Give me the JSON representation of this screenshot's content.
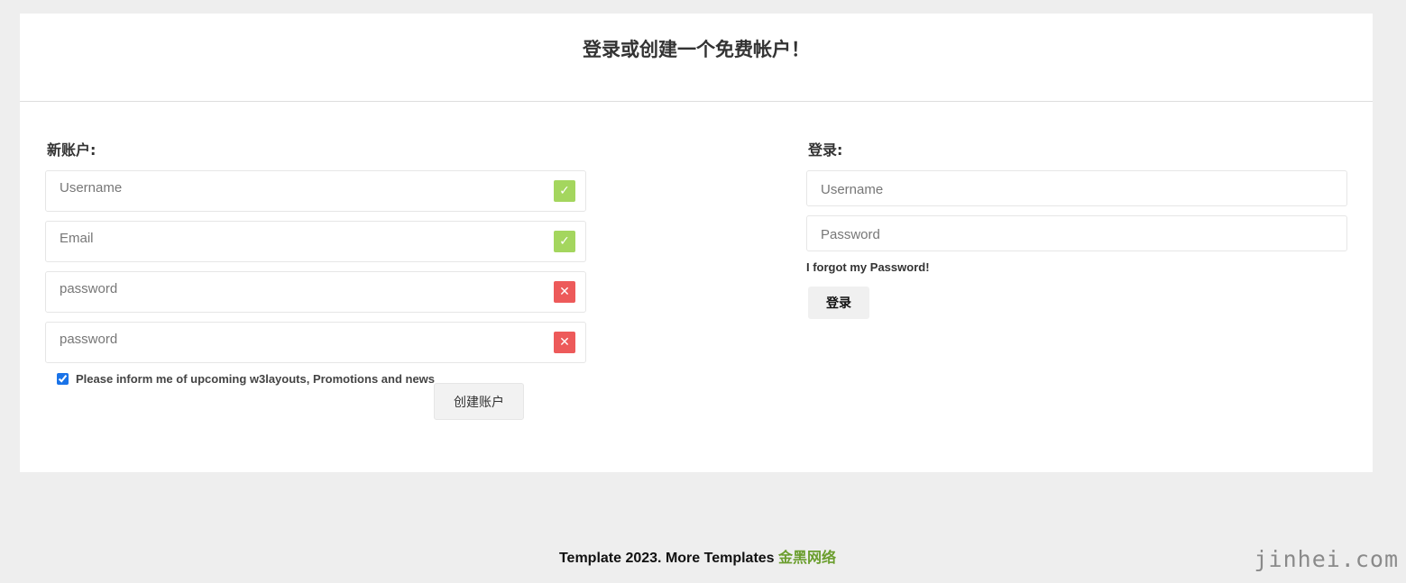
{
  "header": {
    "title": "登录或创建一个免费帐户！"
  },
  "register": {
    "heading": "新账户:",
    "fields": [
      {
        "placeholder": "Username",
        "status": "ok",
        "status_icon": "check-icon"
      },
      {
        "placeholder": "Email",
        "status": "ok",
        "status_icon": "check-icon"
      },
      {
        "placeholder": "password",
        "status": "error",
        "status_icon": "x-icon"
      },
      {
        "placeholder": "password",
        "status": "error",
        "status_icon": "x-icon"
      }
    ],
    "newsletter_label": "Please inform me of upcoming w3layouts, Promotions and news",
    "newsletter_checked": true,
    "submit_label": "创建账户"
  },
  "login": {
    "heading": "登录:",
    "username_placeholder": "Username",
    "password_placeholder": "Password",
    "forgot_label": "I forgot my Password!",
    "submit_label": "登录"
  },
  "footer": {
    "text": "Template 2023. More Templates ",
    "link_label": "金黑网络"
  },
  "watermark": "jinhei.com",
  "colors": {
    "ok": "#a4d65e",
    "error": "#ed5a5a",
    "link": "#6b9e2e"
  }
}
